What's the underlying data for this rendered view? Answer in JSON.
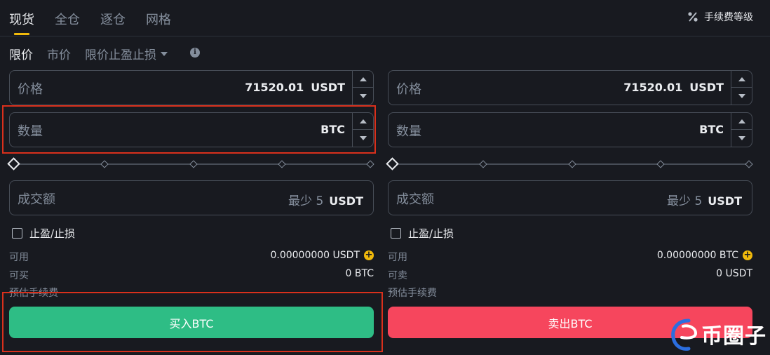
{
  "tabs": [
    {
      "label": "现货",
      "active": true
    },
    {
      "label": "全仓",
      "active": false
    },
    {
      "label": "逐仓",
      "active": false
    },
    {
      "label": "网格",
      "active": false
    }
  ],
  "fee_level": {
    "label": "手续费等级",
    "icon": "percent-icon"
  },
  "order_types": [
    {
      "label": "限价",
      "active": true
    },
    {
      "label": "市价",
      "active": false
    },
    {
      "label": "限价止盈止损",
      "active": false,
      "dropdown": true
    }
  ],
  "buy": {
    "price_label": "价格",
    "price_value": "71520.01",
    "price_unit": "USDT",
    "amount_label": "数量",
    "amount_value": "",
    "amount_unit": "BTC",
    "total_label": "成交额",
    "total_min": "最少 5",
    "total_unit": "USDT",
    "tpsl_label": "止盈/止损",
    "available_label": "可用",
    "available_value": "0.00000000 USDT",
    "max_label": "可买",
    "max_value": "0 BTC",
    "fee_label": "预估手续费",
    "button_label": "买入BTC",
    "color": "#2ebd85"
  },
  "sell": {
    "price_label": "价格",
    "price_value": "71520.01",
    "price_unit": "USDT",
    "amount_label": "数量",
    "amount_value": "",
    "amount_unit": "BTC",
    "total_label": "成交额",
    "total_min": "最少 5",
    "total_unit": "USDT",
    "tpsl_label": "止盈/止损",
    "available_label": "可用",
    "available_value": "0.00000000 BTC",
    "max_label": "可卖",
    "max_value": "0 USDT",
    "fee_label": "预估手续费",
    "button_label": "卖出BTC",
    "color": "#f6465d"
  },
  "slider": {
    "percent": 0,
    "steps": [
      0,
      25,
      50,
      75,
      100
    ]
  },
  "watermark": {
    "text": "币圈子"
  },
  "colors": {
    "accent": "#f0b90b",
    "background": "#181a20",
    "highlight": "#d9301c"
  }
}
